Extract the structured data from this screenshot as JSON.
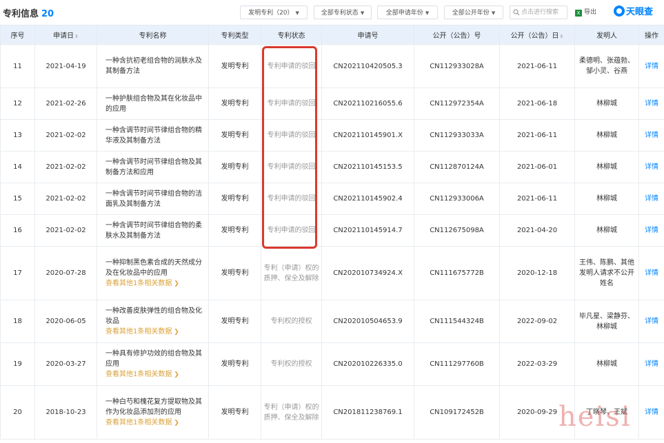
{
  "header": {
    "title": "专利信息",
    "count": "20",
    "filters": [
      {
        "label": "发明专利（20）"
      },
      {
        "label": "全部专利状态"
      },
      {
        "label": "全部申请年份"
      },
      {
        "label": "全部公开年份"
      }
    ],
    "search_placeholder": "点击进行搜索",
    "export_label": "导出",
    "brand": "天眼查"
  },
  "columns": [
    "序号",
    "申请日",
    "专利名称",
    "专利类型",
    "专利状态",
    "申请号",
    "公开（公告）号",
    "公开（公告）日",
    "发明人",
    "操作"
  ],
  "rows": [
    {
      "no": "11",
      "date": "2021-04-19",
      "name": "一种含抗初老组合物的润肤水及其制备方法",
      "related": "",
      "type": "发明专利",
      "status": "专利申请的驳回",
      "app_no": "CN202110420505.3",
      "pub_no": "CN112933028A",
      "pub_date": "2021-06-11",
      "inventor": "柔德明、张蕴勃、邹小灵、谷燕",
      "op": "详情"
    },
    {
      "no": "12",
      "date": "2021-02-26",
      "name": "一种护肤组合物及其在化妆品中的应用",
      "related": "",
      "type": "发明专利",
      "status": "专利申请的驳回",
      "app_no": "CN202110216055.6",
      "pub_no": "CN112972354A",
      "pub_date": "2021-06-18",
      "inventor": "林柳城",
      "op": "详情"
    },
    {
      "no": "13",
      "date": "2021-02-02",
      "name": "一种含调节时间节律组合物的精华液及其制备方法",
      "related": "",
      "type": "发明专利",
      "status": "专利申请的驳回",
      "app_no": "CN202110145901.X",
      "pub_no": "CN112933033A",
      "pub_date": "2021-06-11",
      "inventor": "林柳城",
      "op": "详情"
    },
    {
      "no": "14",
      "date": "2021-02-02",
      "name": "一种含调节时间节律组合物及其制备方法和应用",
      "related": "",
      "type": "发明专利",
      "status": "专利申请的驳回",
      "app_no": "CN202110145153.5",
      "pub_no": "CN112870124A",
      "pub_date": "2021-06-01",
      "inventor": "林柳城",
      "op": "详情"
    },
    {
      "no": "15",
      "date": "2021-02-02",
      "name": "一种含调节时间节律组合物的洁面乳及其制备方法",
      "related": "",
      "type": "发明专利",
      "status": "专利申请的驳回",
      "app_no": "CN202110145902.4",
      "pub_no": "CN112933006A",
      "pub_date": "2021-06-11",
      "inventor": "林柳城",
      "op": "详情"
    },
    {
      "no": "16",
      "date": "2021-02-02",
      "name": "一种含调节时间节律组合物的柔肤水及其制备方法",
      "related": "",
      "type": "发明专利",
      "status": "专利申请的驳回",
      "app_no": "CN202110145914.7",
      "pub_no": "CN112675098A",
      "pub_date": "2021-04-20",
      "inventor": "林柳城",
      "op": "详情"
    },
    {
      "no": "17",
      "date": "2020-07-28",
      "name": "一种抑制黑色素合成的天然成分及在化妆品中的应用",
      "related": "查看其他1条相关数据",
      "type": "发明专利",
      "status": "专利（申请）权的质押、保全及解除",
      "app_no": "CN202010734924.X",
      "pub_no": "CN111675772B",
      "pub_date": "2020-12-18",
      "inventor": "王伟、陈鹏、其他发明人请求不公开姓名",
      "op": "详情"
    },
    {
      "no": "18",
      "date": "2020-06-05",
      "name": "一种改善皮肤弹性的组合物及化妆品",
      "related": "查看其他1条相关数据",
      "type": "发明专利",
      "status": "专利权的授权",
      "app_no": "CN202010504653.9",
      "pub_no": "CN111544324B",
      "pub_date": "2022-09-02",
      "inventor": "毕凡星、梁静芬、林柳城",
      "op": "详情"
    },
    {
      "no": "19",
      "date": "2020-03-27",
      "name": "一种具有修护功效的组合物及其应用",
      "related": "查看其他1条相关数据",
      "type": "发明专利",
      "status": "专利权的授权",
      "app_no": "CN202010226335.0",
      "pub_no": "CN111297760B",
      "pub_date": "2022-03-29",
      "inventor": "林柳城",
      "op": "详情"
    },
    {
      "no": "20",
      "date": "2018-10-23",
      "name": "一种白芍和槐花复方提取物及其作为化妆品添加剂的应用",
      "related": "查看其他1条相关数据",
      "type": "发明专利",
      "status": "专利（申请）权的质押、保全及解除",
      "app_no": "CN201811238769.1",
      "pub_no": "CN109172452B",
      "pub_date": "2020-09-29",
      "inventor": "丁晓琴、王斌",
      "op": "详情"
    }
  ],
  "watermark": "heisi"
}
